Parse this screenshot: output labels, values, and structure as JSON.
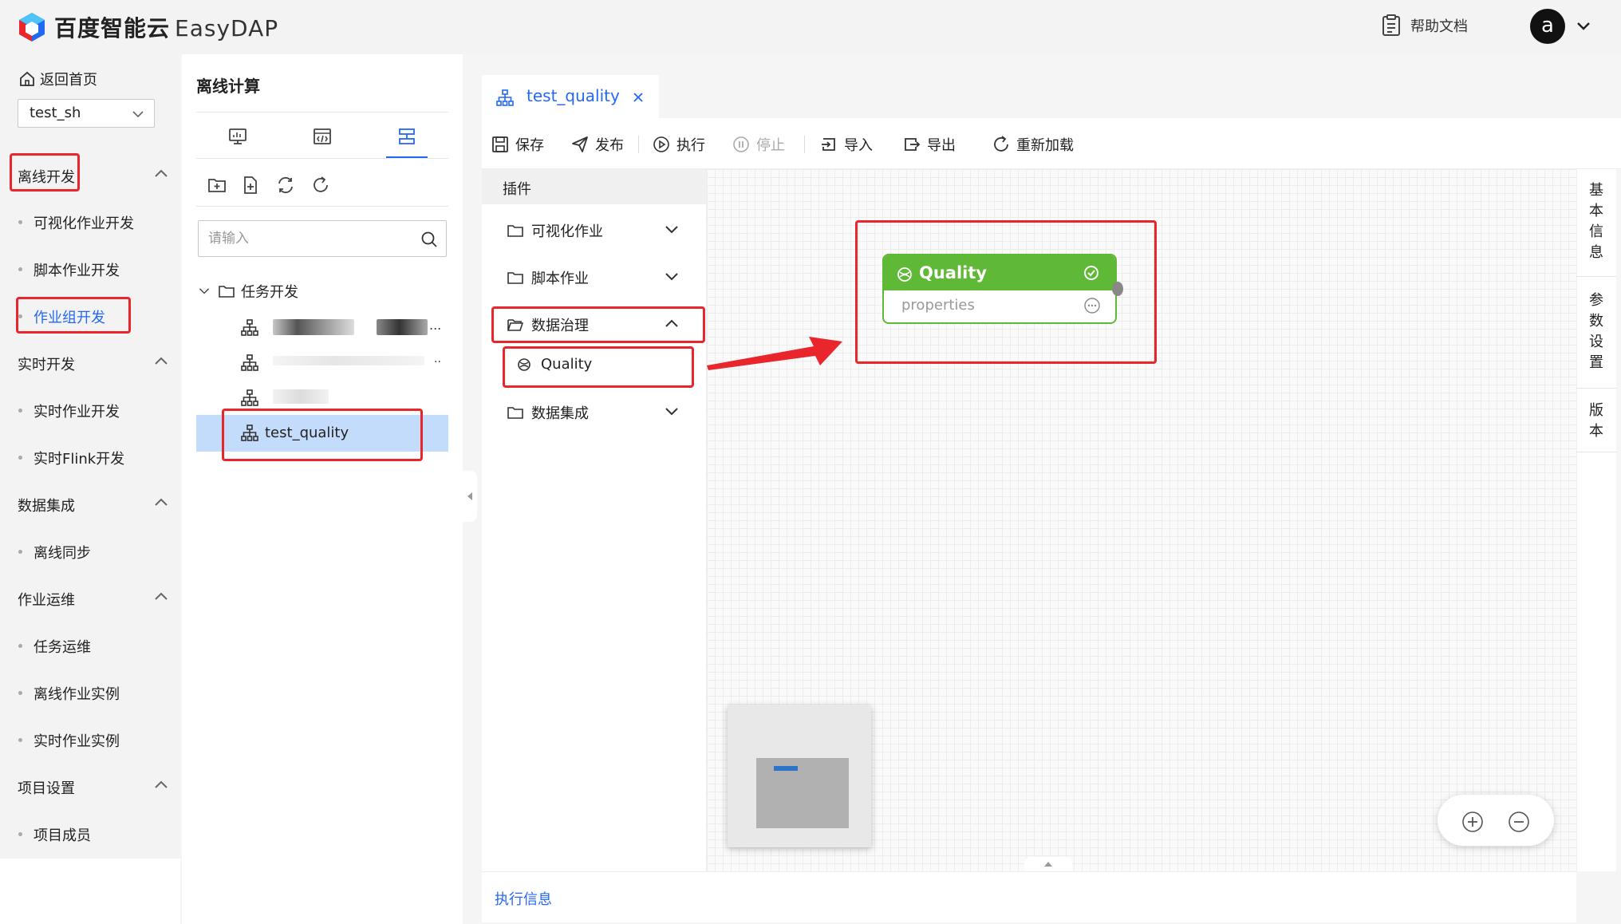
{
  "header": {
    "brand": "百度智能云",
    "product": "EasyDAP",
    "help_label": "帮助文档",
    "avatar_letter": "a"
  },
  "leftnav": {
    "back_label": "返回首页",
    "project": "test_sh",
    "groups": [
      {
        "label": "离线开发",
        "items": [
          "可视化作业开发",
          "脚本作业开发",
          "作业组开发"
        ]
      },
      {
        "label": "实时开发",
        "items": [
          "实时作业开发",
          "实时Flink开发"
        ]
      },
      {
        "label": "数据集成",
        "items": [
          "离线同步"
        ]
      },
      {
        "label": "作业运维",
        "items": [
          "任务运维",
          "离线作业实例",
          "实时作业实例"
        ]
      },
      {
        "label": "项目设置",
        "items": [
          "项目成员"
        ]
      }
    ],
    "active_item": "作业组开发"
  },
  "tree": {
    "title": "离线计算",
    "search_placeholder": "请输入",
    "folder": "任务开发",
    "selected_item": "test_quality",
    "blurred_suffix": "...",
    "blurred_suffix_2": ".."
  },
  "tab": {
    "label": "test_quality"
  },
  "toolbar": {
    "save": "保存",
    "publish": "发布",
    "run": "执行",
    "stop": "停止",
    "import": "导入",
    "export": "导出",
    "reload": "重新加载"
  },
  "plugins": {
    "header": "插件",
    "groups": [
      "可视化作业",
      "脚本作业",
      "数据治理",
      "数据集成"
    ],
    "child": "Quality"
  },
  "node": {
    "title": "Quality",
    "subtitle": "properties",
    "status_color": "#5fb836"
  },
  "right_rail": {
    "basic_info": [
      "基",
      "本",
      "信",
      "息"
    ],
    "params": [
      "参",
      "数",
      "设",
      "置"
    ],
    "version": [
      "版",
      "本"
    ]
  },
  "footer": {
    "exec_info": "执行信息"
  },
  "colors": {
    "accent": "#2468f2",
    "highlight": "#e8262b",
    "selected_bg": "#c4dcfb"
  }
}
